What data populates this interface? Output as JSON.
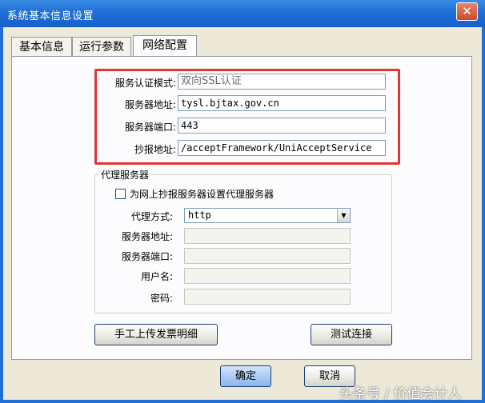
{
  "window": {
    "title": "系统基本信息设置",
    "close_glyph": "✕"
  },
  "tabs": [
    {
      "label": "基本信息"
    },
    {
      "label": "运行参数"
    },
    {
      "label": "网络配置"
    }
  ],
  "network": {
    "auth_mode_label": "服务认证模式:",
    "auth_mode_value": "双向SSL认证",
    "server_addr_label": "服务器地址:",
    "server_addr_value": "tysl.bjtax.gov.cn",
    "server_port_label": "服务器端口:",
    "server_port_value": "443",
    "report_addr_label": "抄报地址:",
    "report_addr_value": "/acceptFramework/UniAcceptService"
  },
  "proxy": {
    "group_title": "代理服务器",
    "checkbox_label": "为网上抄报服务器设置代理服务器",
    "checkbox_checked": false,
    "mode_label": "代理方式:",
    "mode_value": "http",
    "server_addr_label": "服务器地址:",
    "server_port_label": "服务器端口:",
    "username_label": "用户名:",
    "password_label": "密码:"
  },
  "buttons": {
    "manual_upload": "手工上传发票明细",
    "test_connection": "测试连接",
    "ok": "确定",
    "cancel": "取消"
  },
  "watermark": "头条号 / 价值会计人",
  "colors": {
    "titlebar": "#1f6fd6",
    "highlight_box": "#e53333",
    "dialog_bg": "#ece9d8"
  }
}
